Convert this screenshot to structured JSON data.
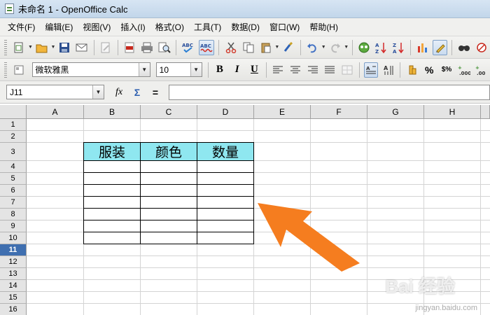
{
  "window": {
    "title": "未命名 1 - OpenOffice Calc"
  },
  "menu": [
    "文件(F)",
    "编辑(E)",
    "视图(V)",
    "插入(I)",
    "格式(O)",
    "工具(T)",
    "数据(D)",
    "窗口(W)",
    "帮助(H)"
  ],
  "toolbar": {
    "spell_label": "ABC",
    "autospell_label": "ABC"
  },
  "format": {
    "font_name": "微软雅黑",
    "font_size": "10",
    "bold": "B",
    "italic": "I",
    "underline": "U",
    "percent": "%",
    "currency": "$%"
  },
  "formula_bar": {
    "cell_ref": "J11",
    "fx": "fx",
    "sum": "Σ",
    "equals": "=",
    "content": ""
  },
  "sheet": {
    "columns": [
      "A",
      "B",
      "C",
      "D",
      "E",
      "F",
      "G",
      "H"
    ],
    "rows": [
      "1",
      "2",
      "3",
      "4",
      "5",
      "6",
      "7",
      "8",
      "9",
      "10",
      "11",
      "12",
      "13",
      "14",
      "15",
      "16"
    ],
    "selected_row": "11",
    "table_headers": [
      "服装",
      "颜色",
      "数量"
    ]
  },
  "watermark": {
    "logo": "Bai 经验",
    "url": "jingyan.baidu.com"
  },
  "colors": {
    "header_fill": "#8fe7f0",
    "arrow": "#f57d1f",
    "selected_row": "#3f6fb0"
  }
}
